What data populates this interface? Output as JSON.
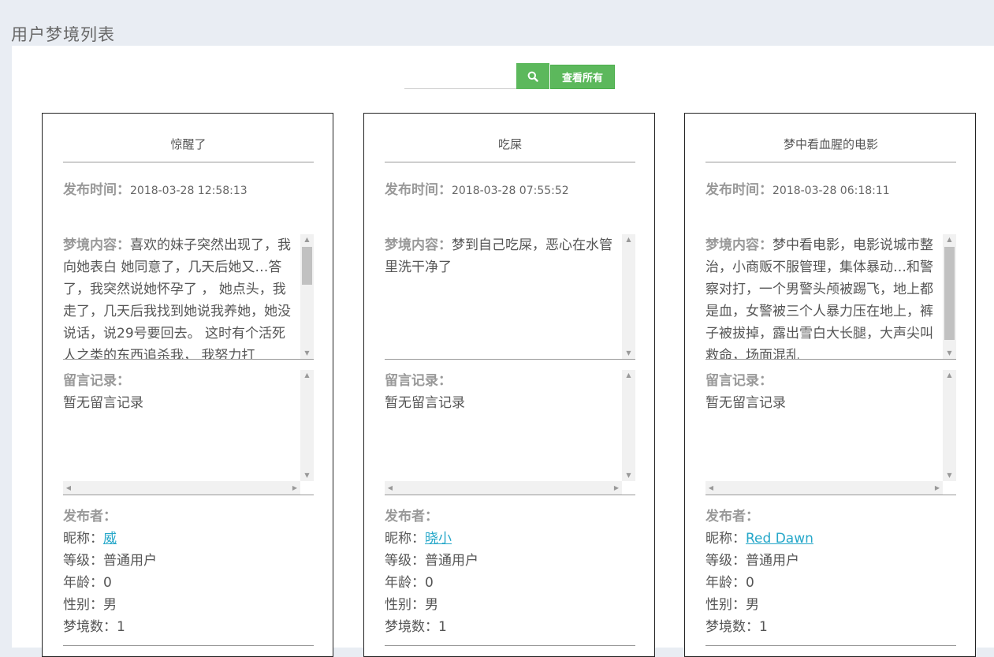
{
  "page_title": "用户梦境列表",
  "search": {
    "placeholder": "",
    "icon": "search-icon",
    "view_all_label": "查看所有"
  },
  "labels": {
    "time": "发布时间：",
    "content": "梦境内容：",
    "messages": "留言记录：",
    "publisher": "发布者：",
    "nickname": "昵称：",
    "level": "等级：",
    "age": "年龄：",
    "gender": "性别：",
    "dream_count": "梦境数："
  },
  "colors": {
    "accent": "#5cb85c",
    "link": "#25a7c9"
  },
  "cards": [
    {
      "title": "惊醒了",
      "time": "2018-03-28 12:58:13",
      "content": "喜欢的妹子突然出现了，我向她表白 她同意了，几天后她又…答了，我突然说她怀孕了 ， 她点头，我走了，几天后我找到她说我养她，她没说话，说29号要回去。 这时有个活死人之类的东西追杀我， 我努力打",
      "messages": "暂无留言记录",
      "nickname": "威",
      "level": "普通用户",
      "age": "0",
      "gender": "男",
      "dream_count": "1"
    },
    {
      "title": "吃屎",
      "time": "2018-03-28 07:55:52",
      "content": "梦到自己吃屎，恶心在水管里洗干净了",
      "messages": "暂无留言记录",
      "nickname": "晓小",
      "level": "普通用户",
      "age": "0",
      "gender": "男",
      "dream_count": "1"
    },
    {
      "title": "梦中看血腥的电影",
      "time": "2018-03-28 06:18:11",
      "content": "梦中看电影，电影说城市整治，小商贩不服管理，集体暴动…和警察对打，一个男警头颅被踢飞，地上都是血，女警被三个人暴力压在地上，裤子被拔掉，露出雪白大长腿，大声尖叫救命，场面混乱",
      "messages": "暂无留言记录",
      "nickname": "Red Dawn",
      "level": "普通用户",
      "age": "0",
      "gender": "男",
      "dream_count": "1"
    }
  ]
}
